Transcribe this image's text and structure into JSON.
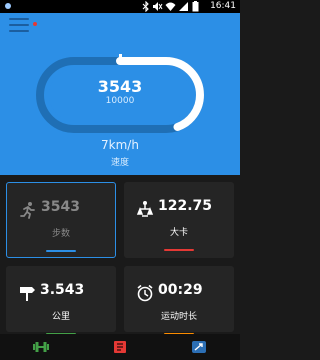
{
  "status_bar": {
    "time": "16:41"
  },
  "hero": {
    "steps": "3543",
    "goal": "10000",
    "speed": "7km/h",
    "speed_label": "速度",
    "progress": 0.3543
  },
  "tiles": [
    {
      "value": "3543",
      "label": "步数",
      "bar_color": "#2c8fe6"
    },
    {
      "value": "122.75",
      "label": "大卡",
      "bar_color": "#e53935"
    },
    {
      "value": "3.543",
      "label": "公里",
      "bar_color": "#43a047"
    },
    {
      "value": "00:29",
      "label": "运动时长",
      "bar_color": "#fb8c00"
    }
  ],
  "colors": {
    "accent": "#2c8fe6",
    "track_dark": "#1f6fb5"
  }
}
